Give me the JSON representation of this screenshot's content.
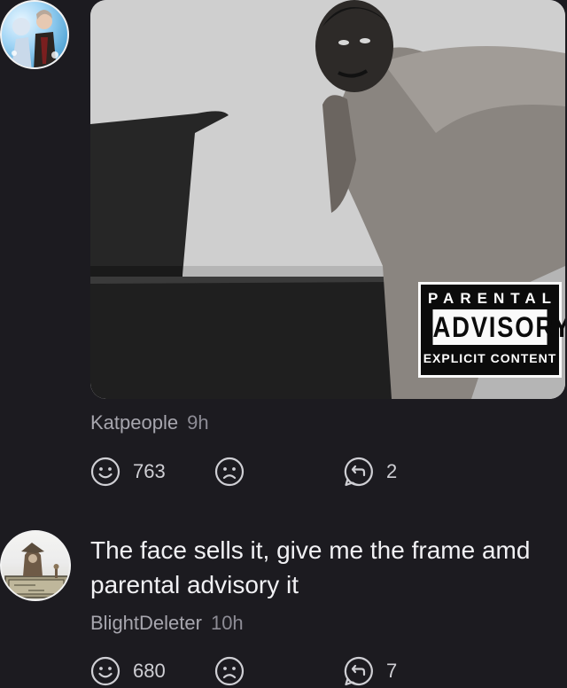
{
  "comments": [
    {
      "author": "Katpeople",
      "time": "9h",
      "likes": "763",
      "replies": "2",
      "image": {
        "parental_advisory": {
          "top": "PARENTAL",
          "middle": "ADVISORY",
          "bottom": "EXPLICIT CONTENT"
        }
      }
    },
    {
      "author": "BlightDeleter",
      "time": "10h",
      "text": "The face sells it, give me the frame amd parental advisory it",
      "likes": "680",
      "replies": "7"
    }
  ],
  "icons": {
    "like": "smile-icon",
    "dislike": "frown-icon",
    "reply": "reply-icon"
  },
  "colors": {
    "background": "#1c1b20",
    "meta_text": "#9e9da6",
    "body_text": "#f1f1f4"
  }
}
